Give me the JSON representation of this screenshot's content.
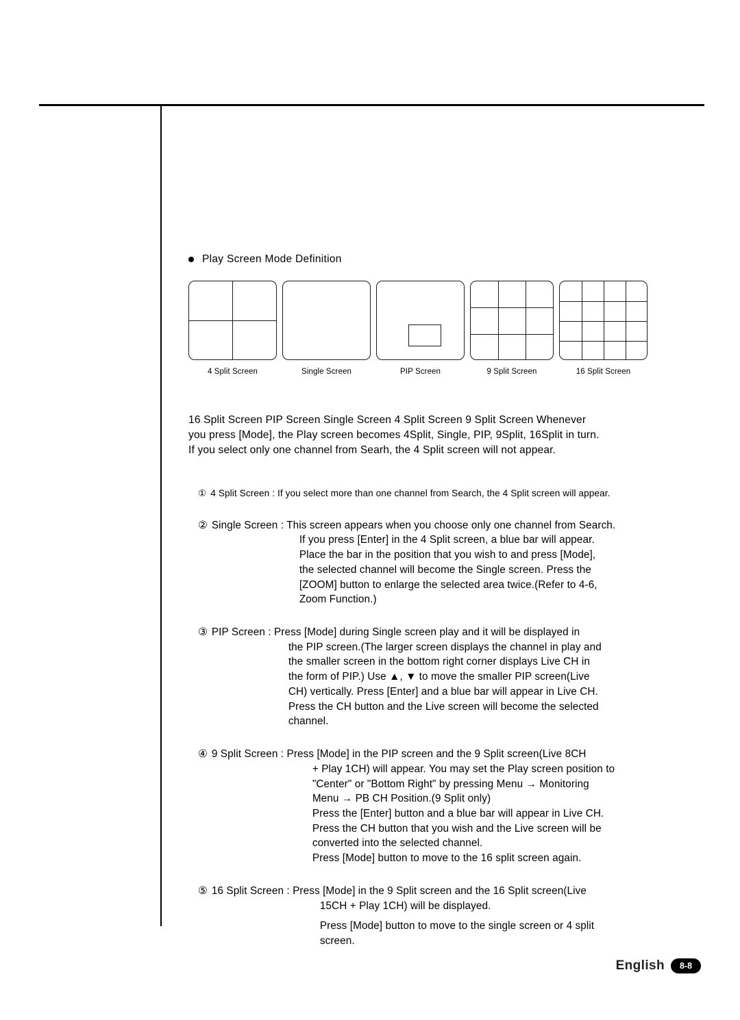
{
  "page": {
    "heading": "Play Screen Mode Definition",
    "footer_language": "English",
    "footer_page": "8-8"
  },
  "figures": [
    {
      "caption": "4 Split Screen",
      "type": "split4"
    },
    {
      "caption": "Single Screen",
      "type": "single"
    },
    {
      "caption": "PIP Screen",
      "type": "pip"
    },
    {
      "caption": "9 Split Screen",
      "type": "split9"
    },
    {
      "caption": "16 Split Screen",
      "type": "split16"
    }
  ],
  "intro": {
    "line1": "16 Split Screen PIP Screen Single Screen 4 Split Screen 9 Split Screen Whenever",
    "line2": "you press [Mode], the Play screen becomes 4Split, Single, PIP, 9Split, 16Split in turn.",
    "line3": "If you select only one channel from Searh, the 4 Split screen will not appear."
  },
  "items": [
    {
      "num": "①",
      "lines": [
        "4 Split Screen : If you select more than one channel from Search, the 4 Split screen will appear."
      ]
    },
    {
      "num": "②",
      "lines": [
        "Single Screen : This screen appears when you choose only one channel from Search.",
        "If you press [Enter] in the 4 Split screen, a blue bar will appear.",
        "Place the bar in the position that you wish to and press [Mode],",
        "the selected channel will become the Single screen. Press the",
        "[ZOOM] button to enlarge the selected area twice.(Refer to 4-6,",
        "Zoom Function.)"
      ]
    },
    {
      "num": "③",
      "lines": [
        "PIP Screen : Press [Mode] during Single screen play and it will be displayed in",
        "the PIP screen.(The larger screen displays the channel in play and",
        "the smaller screen in the bottom right corner displays Live CH in",
        "the form of PIP.) Use ▲, ▼ to move the smaller PIP screen(Live",
        "CH) vertically. Press [Enter] and a blue bar will appear in Live CH.",
        "Press the CH button and the Live screen will become the selected",
        "channel."
      ]
    },
    {
      "num": "④",
      "lines": [
        "9 Split Screen :  Press [Mode] in the PIP screen and the 9 Split screen(Live 8CH",
        "+ Play 1CH) will appear. You may set the Play screen position to",
        "\"Center\" or \"Bottom Right\" by pressing Menu → Monitoring",
        "Menu → PB CH Position.(9 Split only)",
        "Press the [Enter] button and a blue bar will appear in Live CH.",
        "Press the CH button that you wish and the Live screen will be",
        "converted into the selected channel.",
        "Press [Mode] button to move to the 16 split screen again."
      ]
    },
    {
      "num": "⑤",
      "lines": [
        "16 Split Screen : Press [Mode] in the 9 Split screen and the 16 Split screen(Live",
        "15CH + Play 1CH) will be displayed.",
        "Press [Mode] button to move to the single screen or 4 split",
        "screen."
      ]
    }
  ]
}
